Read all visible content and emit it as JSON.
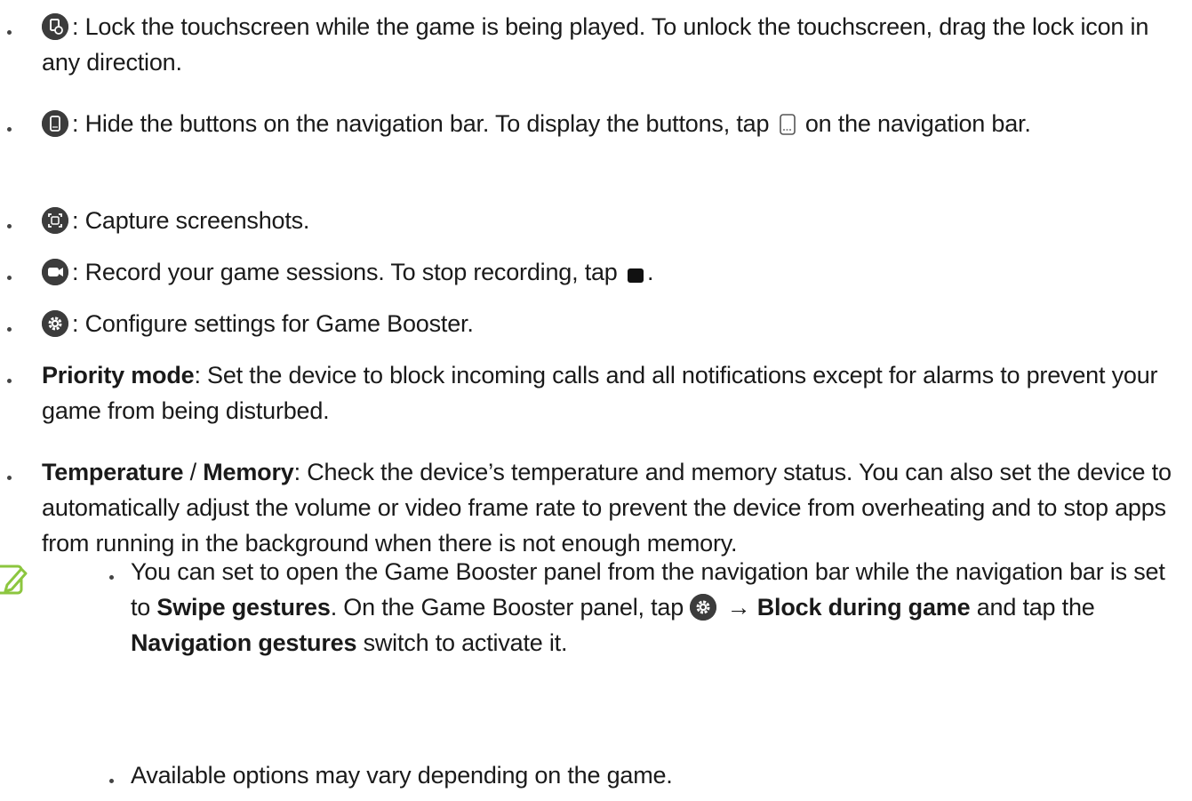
{
  "items": [
    {
      "icon": "lock-touchscreen-icon",
      "text": ": Lock the touchscreen while the game is being played. To unlock the touchscreen, drag the lock icon in any direction."
    },
    {
      "icon": "hide-navigation-icon",
      "text_a": ": Hide the buttons on the navigation bar. To display the buttons, tap ",
      "text_b": " on the navigation bar."
    },
    {
      "icon": "screenshot-icon",
      "text": ": Capture screenshots."
    },
    {
      "icon": "record-icon",
      "text_a": ": Record your game sessions. To stop recording, tap ",
      "text_b": "."
    },
    {
      "icon": "settings-icon",
      "text": ": Configure settings for Game Booster."
    },
    {
      "term": "Priority mode",
      "text": ": Set the device to block incoming calls and all notifications except for alarms to prevent your game from being disturbed."
    },
    {
      "term1": "Temperature",
      "sep": " / ",
      "term2": "Memory",
      "text": ": Check the device’s temperature and memory status. You can also set the device to automatically adjust the volume or video frame rate to prevent the device from overheating and to stop apps from running in the background when there is not enough memory."
    }
  ],
  "notes": [
    {
      "a": "You can set to open the Game Booster panel from the navigation bar while the navigation bar is set to ",
      "b1": "Swipe gestures",
      "c": ". On the Game Booster panel, tap ",
      "arrow": " → ",
      "b2": "Block during game",
      "d": " and tap the ",
      "b3": "Navigation gestures",
      "e": " switch to activate it."
    },
    {
      "text": "Available options may vary depending on the game."
    }
  ],
  "colors": {
    "note_icon": "#8cc63f",
    "icon_bg": "#3c3c3c"
  }
}
